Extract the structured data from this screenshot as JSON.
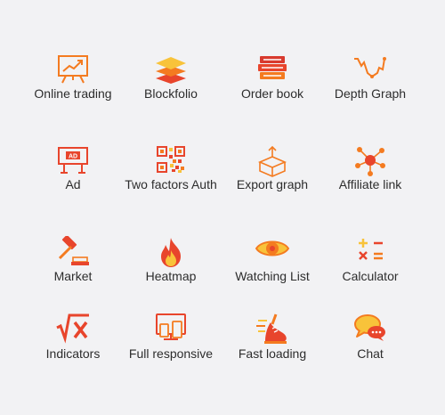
{
  "colors": {
    "orange": "#f47b20",
    "red": "#e8452c",
    "yellow": "#f8c33a",
    "brand_red": "#d83a2e"
  },
  "features": [
    {
      "label": "Online trading",
      "icon": "chart-board-icon"
    },
    {
      "label": "Blockfolio",
      "icon": "layers-icon"
    },
    {
      "label": "Order book",
      "icon": "books-icon"
    },
    {
      "label": "Depth Graph",
      "icon": "line-graph-icon"
    },
    {
      "label": "Ad",
      "icon": "billboard-icon"
    },
    {
      "label": "Two factors Auth",
      "icon": "qr-code-icon"
    },
    {
      "label": "Export graph",
      "icon": "box-export-icon"
    },
    {
      "label": "Affiliate link",
      "icon": "network-icon"
    },
    {
      "label": "Market",
      "icon": "gavel-icon"
    },
    {
      "label": "Heatmap",
      "icon": "flame-icon"
    },
    {
      "label": "Watching List",
      "icon": "eye-icon"
    },
    {
      "label": "Calculator",
      "icon": "calculator-icon"
    },
    {
      "label": "Indicators",
      "icon": "sqrt-icon"
    },
    {
      "label": "Full responsive",
      "icon": "devices-icon"
    },
    {
      "label": "Fast loading",
      "icon": "running-shoe-icon"
    },
    {
      "label": "Chat",
      "icon": "chat-bubbles-icon"
    }
  ]
}
